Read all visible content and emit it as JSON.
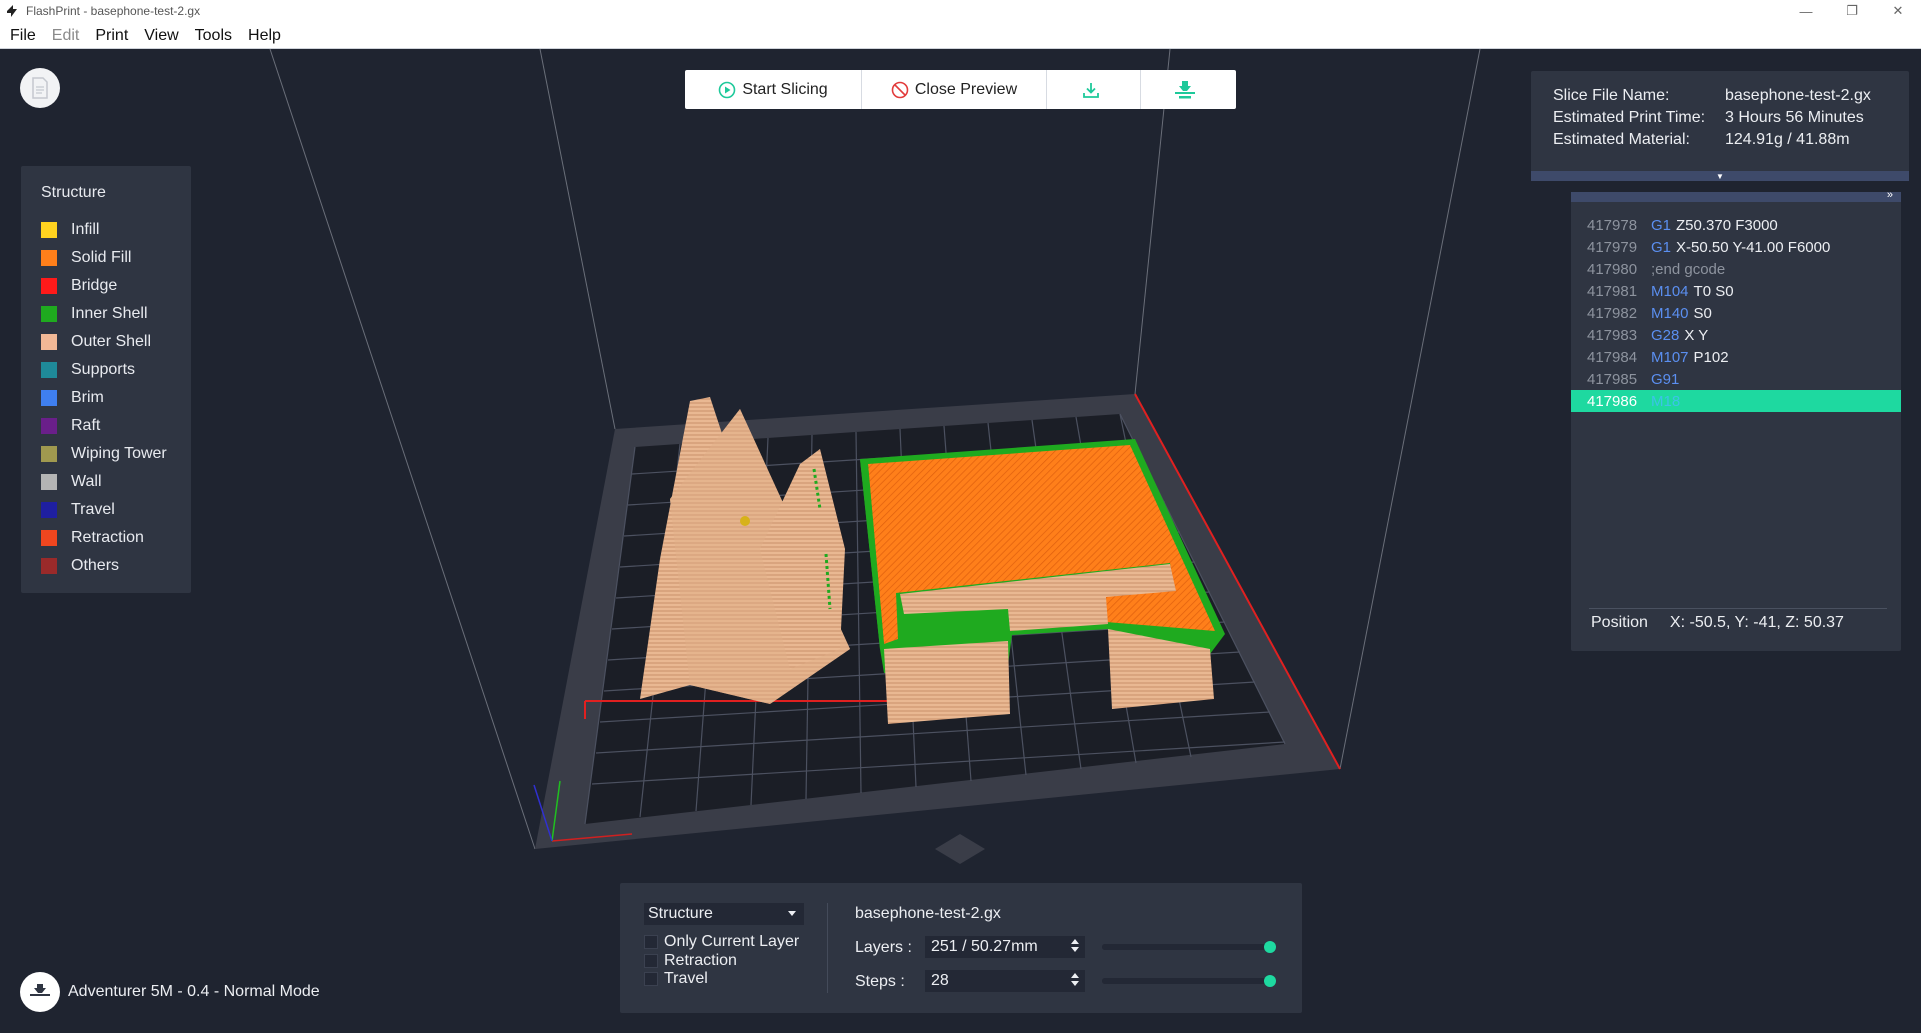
{
  "window": {
    "title": "FlashPrint - basephone-test-2.gx",
    "minimize_icon": "minimize-icon",
    "restore_icon": "restore-icon",
    "close_icon": "close-icon"
  },
  "menu": {
    "items": [
      "File",
      "Edit",
      "Print",
      "View",
      "Tools",
      "Help"
    ]
  },
  "toolbar": {
    "start_slicing": "Start Slicing",
    "close_preview": "Close Preview",
    "accent": "#1ed9a0"
  },
  "legend": {
    "title": "Structure",
    "items": [
      {
        "label": "Infill",
        "color": "#ffd21f"
      },
      {
        "label": "Solid Fill",
        "color": "#ff7f1a"
      },
      {
        "label": "Bridge",
        "color": "#ff1a1a"
      },
      {
        "label": "Inner Shell",
        "color": "#1faa1f"
      },
      {
        "label": "Outer Shell",
        "color": "#f2b896"
      },
      {
        "label": "Supports",
        "color": "#1f8a99"
      },
      {
        "label": "Brim",
        "color": "#3f7ff0"
      },
      {
        "label": "Raft",
        "color": "#6a1f8a"
      },
      {
        "label": "Wiping Tower",
        "color": "#a0994f"
      },
      {
        "label": "Wall",
        "color": "#b4b4b4"
      },
      {
        "label": "Travel",
        "color": "#1f1fa0"
      },
      {
        "label": "Retraction",
        "color": "#f0461f"
      },
      {
        "label": "Others",
        "color": "#9a2a2a"
      }
    ]
  },
  "slice_info": {
    "file_name_label": "Slice File Name:",
    "file_name": "basephone-test-2.gx",
    "print_time_label": "Estimated Print Time:",
    "print_time": "3 Hours 56 Minutes",
    "material_label": "Estimated Material:",
    "material": "124.91g / 41.88m"
  },
  "gcode": {
    "lines": [
      {
        "num": "417978",
        "cmd": "G1",
        "args": "Z50.370 F3000"
      },
      {
        "num": "417979",
        "cmd": "G1",
        "args": "X-50.50 Y-41.00 F6000"
      },
      {
        "num": "417980",
        "cmd": "",
        "args": ";end gcode"
      },
      {
        "num": "417981",
        "cmd": "M104",
        "args": "T0 S0"
      },
      {
        "num": "417982",
        "cmd": "M140",
        "args": "S0"
      },
      {
        "num": "417983",
        "cmd": "G28",
        "args": "X Y"
      },
      {
        "num": "417984",
        "cmd": "M107",
        "args": "P102"
      },
      {
        "num": "417985",
        "cmd": "G91",
        "args": ""
      },
      {
        "num": "417986",
        "cmd": "M18",
        "args": ""
      }
    ],
    "active_index": 8,
    "position_label": "Position",
    "position_value": "X: -50.5, Y: -41, Z: 50.37"
  },
  "bottom": {
    "mode": "Structure",
    "checkboxes": [
      "Only Current Layer",
      "Retraction",
      "Travel"
    ],
    "file_name": "basephone-test-2.gx",
    "layers_label": "Layers :",
    "layers_value": "251 / 50.27mm",
    "steps_label": "Steps :",
    "steps_value": "28",
    "layers_slider_fraction": 1.0,
    "steps_slider_fraction": 1.0
  },
  "machine": {
    "label": "Adventurer 5M - 0.4 - Normal Mode"
  }
}
